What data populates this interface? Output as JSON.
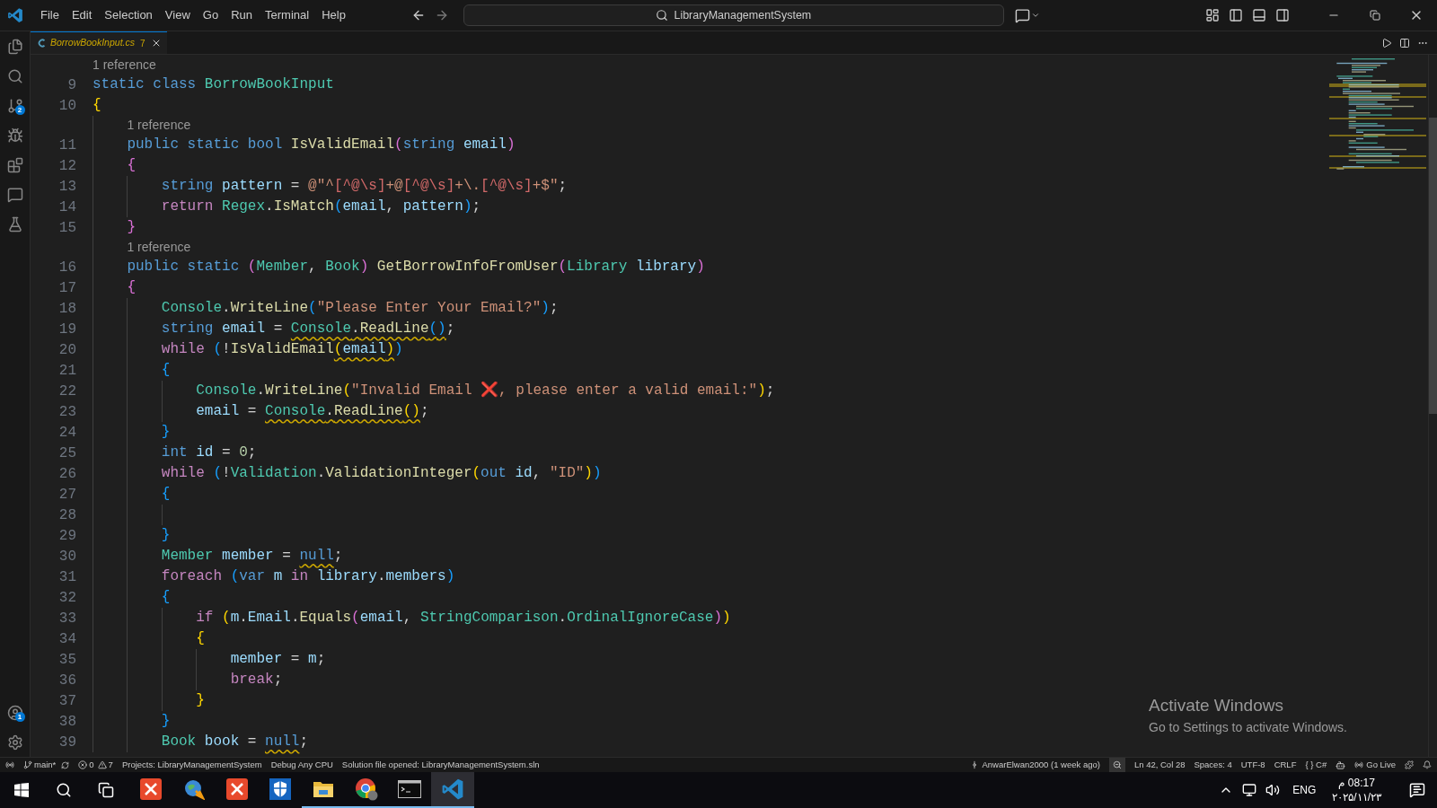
{
  "menu": [
    "File",
    "Edit",
    "Selection",
    "View",
    "Go",
    "Run",
    "Terminal",
    "Help"
  ],
  "search": {
    "label": "LibraryManagementSystem"
  },
  "activity_bar": {
    "source_control_badge": "2",
    "accounts_badge": "1"
  },
  "tab": {
    "title": "BorrowBookInput.cs",
    "problems": "7",
    "selected": true
  },
  "editor": {
    "lines": [
      {
        "kind": "lens",
        "text": "1 reference"
      },
      {
        "kind": "code",
        "number": "9",
        "tokens": [
          {
            "kind": "kw",
            "text": "static class "
          },
          {
            "kind": "type",
            "text": "BorrowBookInput"
          }
        ]
      },
      {
        "kind": "code",
        "number": "10",
        "tokens": [
          {
            "kind": "bracket1",
            "text": "{"
          }
        ]
      },
      {
        "kind": "lens",
        "text": "    1 reference"
      },
      {
        "kind": "code",
        "number": "11",
        "tokens": [
          {
            "kind": "kw",
            "text": "    public static bool "
          },
          {
            "kind": "fn",
            "text": "IsValidEmail"
          },
          {
            "kind": "bracket2",
            "text": "("
          },
          {
            "kind": "kw",
            "text": "string "
          },
          {
            "kind": "var",
            "text": "email"
          },
          {
            "kind": "bracket2",
            "text": ")"
          }
        ]
      },
      {
        "kind": "code",
        "number": "12",
        "tokens": [
          {
            "kind": "bracket2",
            "text": "    {"
          }
        ]
      },
      {
        "kind": "code",
        "number": "13",
        "tokens": [
          {
            "kind": "kw",
            "text": "        string "
          },
          {
            "kind": "var",
            "text": "pattern"
          },
          {
            "kind": "plain",
            "text": " = "
          },
          {
            "kind": "str",
            "text": "@\"^"
          },
          {
            "kind": "regex",
            "text": "[^@\\s]"
          },
          {
            "kind": "str",
            "text": "+@"
          },
          {
            "kind": "regex",
            "text": "[^@\\s]"
          },
          {
            "kind": "str",
            "text": "+\\."
          },
          {
            "kind": "regex",
            "text": "[^@\\s]"
          },
          {
            "kind": "str",
            "text": "+$\""
          },
          {
            "kind": "plain",
            "text": ";"
          }
        ]
      },
      {
        "kind": "code",
        "number": "14",
        "tokens": [
          {
            "kind": "ctrl",
            "text": "        return "
          },
          {
            "kind": "type",
            "text": "Regex"
          },
          {
            "kind": "plain",
            "text": "."
          },
          {
            "kind": "fn",
            "text": "IsMatch"
          },
          {
            "kind": "bracket3",
            "text": "("
          },
          {
            "kind": "var",
            "text": "email"
          },
          {
            "kind": "plain",
            "text": ", "
          },
          {
            "kind": "var",
            "text": "pattern"
          },
          {
            "kind": "bracket3",
            "text": ")"
          },
          {
            "kind": "plain",
            "text": ";"
          }
        ]
      },
      {
        "kind": "code",
        "number": "15",
        "tokens": [
          {
            "kind": "bracket2",
            "text": "    }"
          }
        ]
      },
      {
        "kind": "lens",
        "text": "    1 reference"
      },
      {
        "kind": "code",
        "number": "16",
        "tokens": [
          {
            "kind": "kw",
            "text": "    public static "
          },
          {
            "kind": "bracket2",
            "text": "("
          },
          {
            "kind": "type",
            "text": "Member"
          },
          {
            "kind": "plain",
            "text": ", "
          },
          {
            "kind": "type",
            "text": "Book"
          },
          {
            "kind": "bracket2",
            "text": ")"
          },
          {
            "kind": "fn",
            "text": " GetBorrowInfoFromUser"
          },
          {
            "kind": "bracket2",
            "text": "("
          },
          {
            "kind": "type",
            "text": "Library"
          },
          {
            "kind": "var",
            "text": " library"
          },
          {
            "kind": "bracket2",
            "text": ")"
          }
        ]
      },
      {
        "kind": "code",
        "number": "17",
        "tokens": [
          {
            "kind": "bracket2",
            "text": "    {"
          }
        ]
      },
      {
        "kind": "code",
        "number": "18",
        "tokens": [
          {
            "kind": "type",
            "text": "        Console"
          },
          {
            "kind": "plain",
            "text": "."
          },
          {
            "kind": "fn",
            "text": "WriteLine"
          },
          {
            "kind": "bracket3",
            "text": "("
          },
          {
            "kind": "str",
            "text": "\"Please Enter Your Email?\""
          },
          {
            "kind": "bracket3",
            "text": ")"
          },
          {
            "kind": "plain",
            "text": ";"
          }
        ]
      },
      {
        "kind": "code",
        "number": "19",
        "tokens": [
          {
            "kind": "kw",
            "text": "        string "
          },
          {
            "kind": "var",
            "text": "email"
          },
          {
            "kind": "plain",
            "text": " = "
          },
          {
            "kind": "warn",
            "children": [
              {
                "kind": "type",
                "text": "Console"
              },
              {
                "kind": "plain",
                "text": "."
              },
              {
                "kind": "fn",
                "text": "ReadLine"
              },
              {
                "kind": "bracket3",
                "text": "()"
              }
            ]
          },
          {
            "kind": "plain",
            "text": ";"
          }
        ]
      },
      {
        "kind": "code",
        "number": "20",
        "tokens": [
          {
            "kind": "ctrl",
            "text": "        while "
          },
          {
            "kind": "bracket3",
            "text": "("
          },
          {
            "kind": "plain",
            "text": "!"
          },
          {
            "kind": "fn",
            "text": "IsValidEmail"
          },
          {
            "kind": "warn",
            "children": [
              {
                "kind": "bracket1",
                "text": "("
              },
              {
                "kind": "var",
                "text": "email"
              },
              {
                "kind": "bracket1",
                "text": ")"
              }
            ]
          },
          {
            "kind": "bracket3",
            "text": ")"
          }
        ]
      },
      {
        "kind": "code",
        "number": "21",
        "tokens": [
          {
            "kind": "bracket3",
            "text": "        {"
          }
        ]
      },
      {
        "kind": "code",
        "number": "22",
        "tokens": [
          {
            "kind": "type",
            "text": "            Console"
          },
          {
            "kind": "plain",
            "text": "."
          },
          {
            "kind": "fn",
            "text": "WriteLine"
          },
          {
            "kind": "bracket1",
            "text": "("
          },
          {
            "kind": "str",
            "text": "\"Invalid Email ❌, please enter a valid email:\""
          },
          {
            "kind": "bracket1",
            "text": ")"
          },
          {
            "kind": "plain",
            "text": ";"
          }
        ]
      },
      {
        "kind": "code",
        "number": "23",
        "tokens": [
          {
            "kind": "var",
            "text": "            email"
          },
          {
            "kind": "plain",
            "text": " = "
          },
          {
            "kind": "warn",
            "children": [
              {
                "kind": "type",
                "text": "Console"
              },
              {
                "kind": "plain",
                "text": "."
              },
              {
                "kind": "fn",
                "text": "ReadLine"
              },
              {
                "kind": "bracket1",
                "text": "()"
              }
            ]
          },
          {
            "kind": "plain",
            "text": ";"
          }
        ]
      },
      {
        "kind": "code",
        "number": "24",
        "tokens": [
          {
            "kind": "bracket3",
            "text": "        }"
          }
        ]
      },
      {
        "kind": "code",
        "number": "25",
        "tokens": [
          {
            "kind": "kw",
            "text": "        int "
          },
          {
            "kind": "var",
            "text": "id"
          },
          {
            "kind": "plain",
            "text": " = "
          },
          {
            "kind": "num",
            "text": "0"
          },
          {
            "kind": "plain",
            "text": ";"
          }
        ]
      },
      {
        "kind": "code",
        "number": "26",
        "tokens": [
          {
            "kind": "ctrl",
            "text": "        while "
          },
          {
            "kind": "bracket3",
            "text": "("
          },
          {
            "kind": "plain",
            "text": "!"
          },
          {
            "kind": "type",
            "text": "Validation"
          },
          {
            "kind": "plain",
            "text": "."
          },
          {
            "kind": "fn",
            "text": "ValidationInteger"
          },
          {
            "kind": "bracket1",
            "text": "("
          },
          {
            "kind": "kw",
            "text": "out "
          },
          {
            "kind": "var",
            "text": "id"
          },
          {
            "kind": "plain",
            "text": ", "
          },
          {
            "kind": "str",
            "text": "\"ID\""
          },
          {
            "kind": "bracket1",
            "text": ")"
          },
          {
            "kind": "bracket3",
            "text": ")"
          }
        ]
      },
      {
        "kind": "code",
        "number": "27",
        "tokens": [
          {
            "kind": "bracket3",
            "text": "        {"
          }
        ]
      },
      {
        "kind": "code",
        "number": "28"
      },
      {
        "kind": "code",
        "number": "29",
        "tokens": [
          {
            "kind": "bracket3",
            "text": "        }"
          }
        ]
      },
      {
        "kind": "code",
        "number": "30",
        "tokens": [
          {
            "kind": "type",
            "text": "        Member "
          },
          {
            "kind": "var",
            "text": "member"
          },
          {
            "kind": "plain",
            "text": " = "
          },
          {
            "kind": "warn",
            "children": [
              {
                "kind": "kw",
                "text": "null"
              }
            ]
          },
          {
            "kind": "plain",
            "text": ";"
          }
        ]
      },
      {
        "kind": "code",
        "number": "31",
        "tokens": [
          {
            "kind": "ctrl",
            "text": "        foreach "
          },
          {
            "kind": "bracket3",
            "text": "("
          },
          {
            "kind": "kw",
            "text": "var "
          },
          {
            "kind": "var",
            "text": "m"
          },
          {
            "kind": "ctrl",
            "text": " in "
          },
          {
            "kind": "var",
            "text": "library"
          },
          {
            "kind": "plain",
            "text": "."
          },
          {
            "kind": "var",
            "text": "members"
          },
          {
            "kind": "bracket3",
            "text": ")"
          }
        ]
      },
      {
        "kind": "code",
        "number": "32",
        "tokens": [
          {
            "kind": "bracket3",
            "text": "        {"
          }
        ]
      },
      {
        "kind": "code",
        "number": "33",
        "tokens": [
          {
            "kind": "ctrl",
            "text": "            if "
          },
          {
            "kind": "bracket1",
            "text": "("
          },
          {
            "kind": "var",
            "text": "m"
          },
          {
            "kind": "plain",
            "text": "."
          },
          {
            "kind": "var",
            "text": "Email"
          },
          {
            "kind": "plain",
            "text": "."
          },
          {
            "kind": "fn",
            "text": "Equals"
          },
          {
            "kind": "bracket2",
            "text": "("
          },
          {
            "kind": "var",
            "text": "email"
          },
          {
            "kind": "plain",
            "text": ", "
          },
          {
            "kind": "type",
            "text": "StringComparison"
          },
          {
            "kind": "plain",
            "text": "."
          },
          {
            "kind": "type",
            "text": "OrdinalIgnoreCase"
          },
          {
            "kind": "bracket2",
            "text": ")"
          },
          {
            "kind": "bracket1",
            "text": ")"
          }
        ]
      },
      {
        "kind": "code",
        "number": "34",
        "tokens": [
          {
            "kind": "bracket1",
            "text": "            {"
          }
        ]
      },
      {
        "kind": "code",
        "number": "35",
        "tokens": [
          {
            "kind": "var",
            "text": "                member"
          },
          {
            "kind": "plain",
            "text": " = "
          },
          {
            "kind": "var",
            "text": "m"
          },
          {
            "kind": "plain",
            "text": ";"
          }
        ]
      },
      {
        "kind": "code",
        "number": "36",
        "tokens": [
          {
            "kind": "ctrl",
            "text": "                break"
          },
          {
            "kind": "plain",
            "text": ";"
          }
        ]
      },
      {
        "kind": "code",
        "number": "37",
        "tokens": [
          {
            "kind": "bracket1",
            "text": "            }"
          }
        ]
      },
      {
        "kind": "code",
        "number": "38",
        "tokens": [
          {
            "kind": "bracket3",
            "text": "        }"
          }
        ]
      },
      {
        "kind": "code",
        "number": "39",
        "tokens": [
          {
            "kind": "type",
            "text": "        Book "
          },
          {
            "kind": "var",
            "text": "book"
          },
          {
            "kind": "plain",
            "text": " = "
          },
          {
            "kind": "warn",
            "children": [
              {
                "kind": "kw",
                "text": "null"
              }
            ]
          },
          {
            "kind": "plain",
            "text": ";"
          }
        ]
      }
    ]
  },
  "activation": {
    "title": "Activate Windows",
    "subtitle": "Go to Settings to activate Windows."
  },
  "status_bar": {
    "branch": "main*",
    "errors": "0",
    "warnings": "7",
    "left": [
      "Projects: LibraryManagementSystem",
      "Debug Any CPU",
      "Solution file opened: LibraryManagementSystem.sln"
    ],
    "blame": "AnwarElwan2000 (1 week ago)",
    "right": [
      "Ln 42, Col 28",
      "Spaces: 4",
      "UTF-8",
      "CRLF"
    ],
    "language_braces": "{ }",
    "language": "C#",
    "go_live": "Go Live"
  },
  "taskbar": {
    "apps": [
      {
        "kind": "tool",
        "running": false,
        "selected": false
      },
      {
        "kind": "globe",
        "running": false,
        "selected": false
      },
      {
        "kind": "tool",
        "running": false,
        "selected": false
      },
      {
        "kind": "shield",
        "running": false,
        "selected": false
      },
      {
        "kind": "folder",
        "running": true,
        "selected": false
      },
      {
        "kind": "browser",
        "running": true,
        "selected": false
      },
      {
        "kind": "terminal",
        "running": true,
        "selected": false
      },
      {
        "kind": "editor",
        "running": true,
        "selected": true
      }
    ],
    "language": "ENG",
    "time": "08:17 م",
    "date": "۲۰۲۵/۱۱/۲۳"
  }
}
